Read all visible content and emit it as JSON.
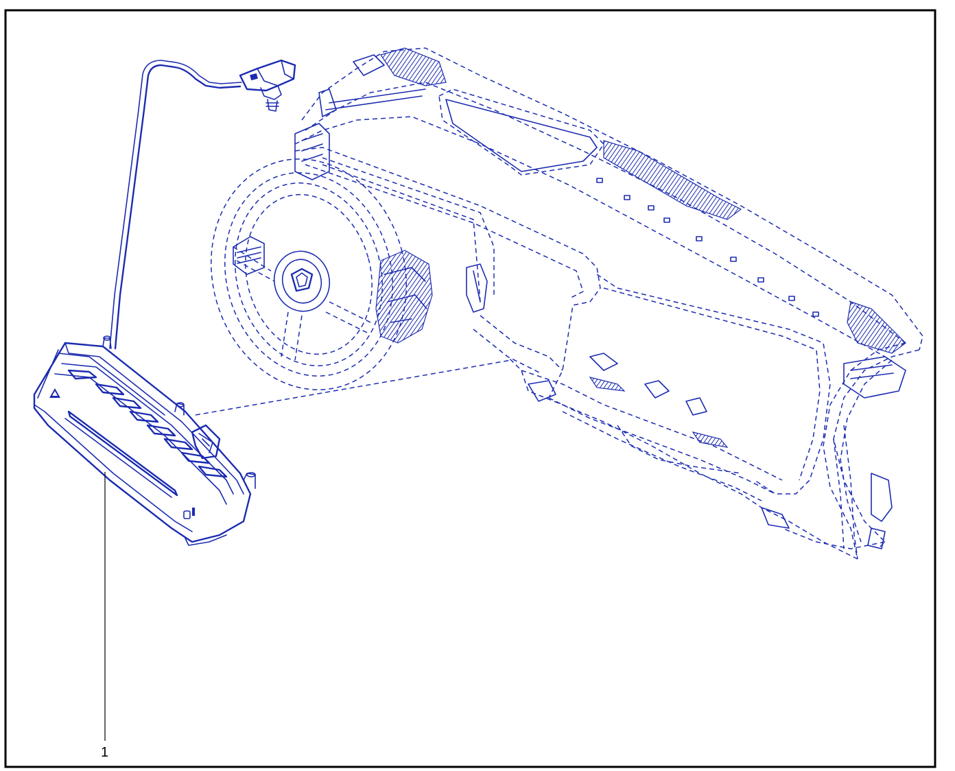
{
  "diagram": {
    "line_color": "#1a2bb0",
    "frame_color": "#000000",
    "callouts": [
      {
        "label": "1"
      }
    ]
  }
}
